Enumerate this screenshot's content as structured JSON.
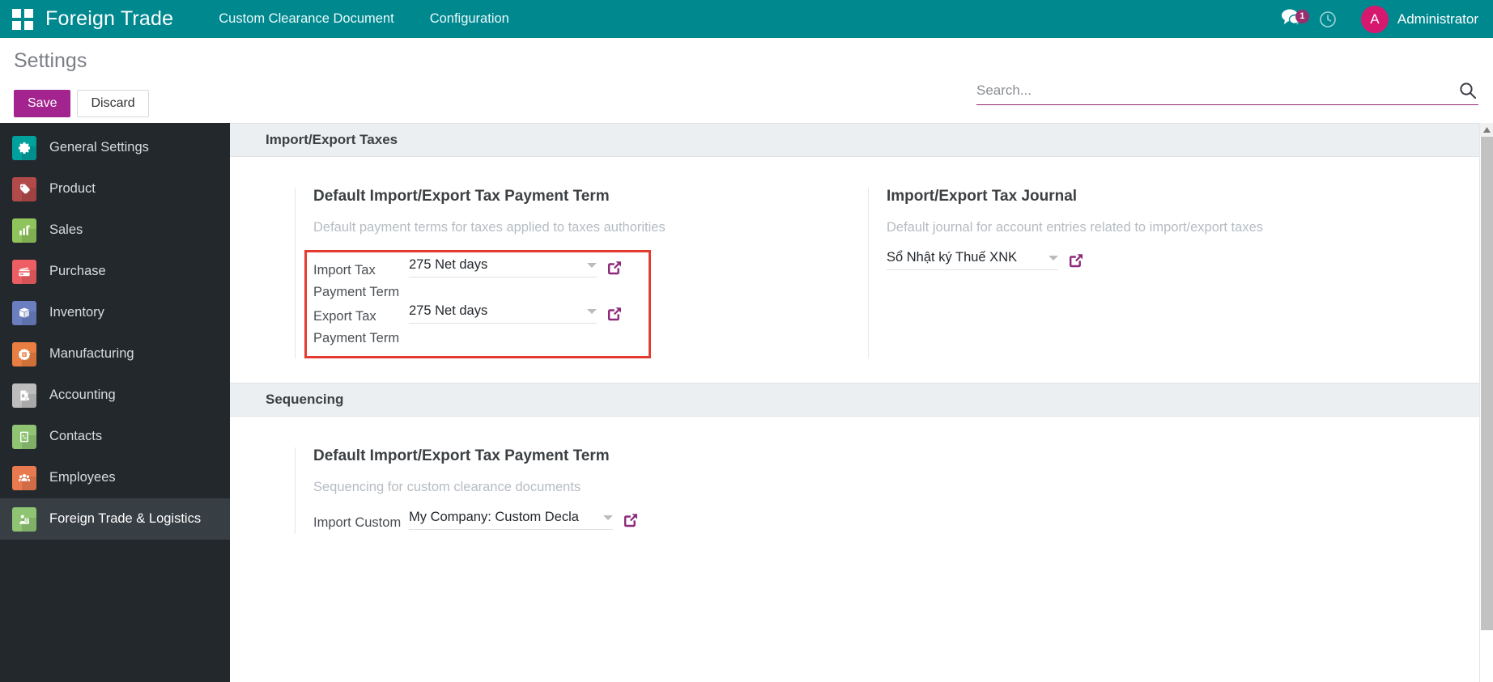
{
  "navbar": {
    "apps_icon": "apps-grid-icon",
    "brand": "Foreign Trade",
    "menus": [
      {
        "label": "Custom Clearance Document"
      },
      {
        "label": "Configuration"
      }
    ],
    "messages_icon": "messages-icon",
    "messages_count": "1",
    "activity_icon": "clock-icon",
    "avatar_initial": "A",
    "user_name": "Administrator",
    "bg_color": "#00888f",
    "badge_color": "#9b2d6f",
    "avatar_color": "#d6186f"
  },
  "control_panel": {
    "title": "Settings",
    "save_label": "Save",
    "discard_label": "Discard",
    "save_color": "#a3248e",
    "search": {
      "value": "",
      "placeholder": "Search...",
      "icon": "search-icon"
    }
  },
  "sidebar": {
    "items": [
      {
        "label": "General Settings",
        "icon": "gear-icon",
        "color": "#00a09d",
        "active": false
      },
      {
        "label": "Product",
        "icon": "tag-icon",
        "color": "#b24a4a",
        "active": false
      },
      {
        "label": "Sales",
        "icon": "bar-chart-icon",
        "color": "#8fc35b",
        "active": false
      },
      {
        "label": "Purchase",
        "icon": "credit-card-icon",
        "color": "#ec5e63",
        "active": false
      },
      {
        "label": "Inventory",
        "icon": "box-icon",
        "color": "#6b7fc0",
        "active": false
      },
      {
        "label": "Manufacturing",
        "icon": "gear-cog-icon",
        "color": "#e87e41",
        "active": false
      },
      {
        "label": "Accounting",
        "icon": "invoice-dollar-icon",
        "color": "#bdbdbd",
        "active": false
      },
      {
        "label": "Contacts",
        "icon": "phone-book-icon",
        "color": "#8fc473",
        "active": false
      },
      {
        "label": "Employees",
        "icon": "users-icon",
        "color": "#e97a4f",
        "active": false
      },
      {
        "label": "Foreign Trade & Logistics",
        "icon": "trade-document-icon",
        "color": "#8fc473",
        "active": true
      }
    ],
    "bg_color": "#23282d",
    "active_bg_color": "#373e44"
  },
  "main": {
    "sections": [
      {
        "title": "Import/Export Taxes",
        "columns": [
          {
            "heading": "Default Import/Export Tax Payment Term",
            "description": "Default payment terms for taxes applied to taxes authorities",
            "highlighted": true,
            "fields": [
              {
                "label": "Import Tax Payment Term",
                "value": "275 Net days",
                "external_link_icon": "external-link-icon",
                "caret_icon": "chevron-down-icon"
              },
              {
                "label": "Export Tax Payment Term",
                "value": "275 Net days",
                "external_link_icon": "external-link-icon",
                "caret_icon": "chevron-down-icon"
              }
            ]
          },
          {
            "heading": "Import/Export Tax Journal",
            "description": "Default journal for account entries related to import/export taxes",
            "highlighted": false,
            "fields": [
              {
                "label": "",
                "value": "Sổ Nhật ký Thuế XNK",
                "external_link_icon": "external-link-icon",
                "caret_icon": "chevron-down-icon"
              }
            ]
          }
        ]
      },
      {
        "title": "Sequencing",
        "columns": [
          {
            "heading": "Default Import/Export Tax Payment Term",
            "description": "Sequencing for custom clearance documents",
            "highlighted": false,
            "fields": [
              {
                "label": "Import Custom",
                "value": "My Company: Custom Decla",
                "external_link_icon": "external-link-icon",
                "caret_icon": "chevron-down-icon"
              }
            ]
          }
        ]
      }
    ],
    "highlight_color": "#e43b30",
    "link_color": "#8e2a7c"
  },
  "scrollbar": {
    "up_arrow_icon": "scroll-up-arrow-icon",
    "thumb": "scroll-thumb"
  }
}
